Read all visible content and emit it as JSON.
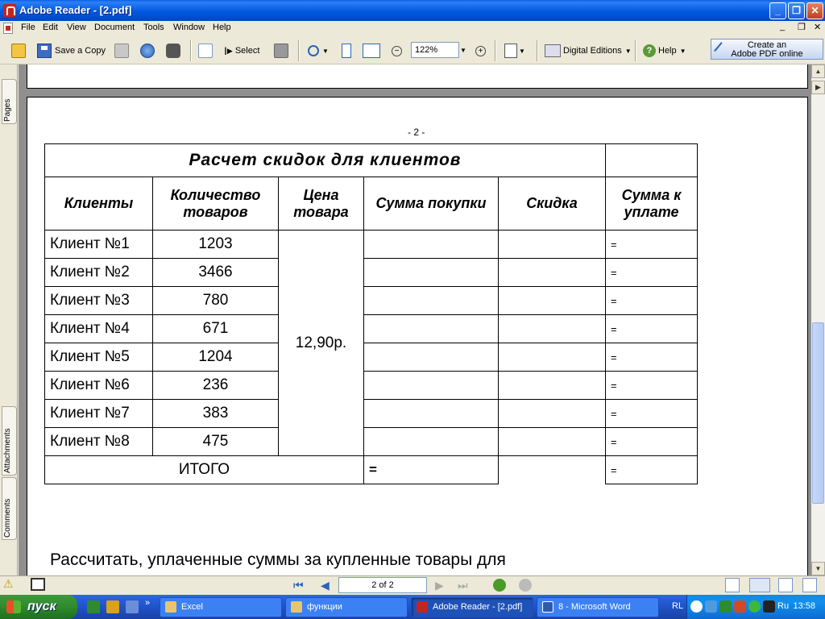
{
  "window": {
    "title": "Adobe Reader - [2.pdf]"
  },
  "menu": [
    "File",
    "Edit",
    "View",
    "Document",
    "Tools",
    "Window",
    "Help"
  ],
  "toolbar": {
    "save_copy": "Save a Copy",
    "select": "Select",
    "zoom_value": "122%",
    "digital_editions": "Digital Editions",
    "help": "Help",
    "create_line1": "Create an",
    "create_line2": "Adobe PDF online"
  },
  "nav_tabs": {
    "pages": "Pages",
    "attachments": "Attachments",
    "comments": "Comments"
  },
  "document": {
    "page_number": "- 2 -",
    "table_title": "Расчет скидок для клиентов",
    "headers": {
      "clients": "Клиенты",
      "quantity": "Количество товаров",
      "price": "Цена товара",
      "sum": "Сумма покупки",
      "discount": "Скидка",
      "to_pay": "Сумма к уплате"
    },
    "price_value": "12,90р.",
    "rows": [
      {
        "client": "Клиент №1",
        "qty": "1203",
        "pay": "="
      },
      {
        "client": "Клиент №2",
        "qty": "3466",
        "pay": "="
      },
      {
        "client": "Клиент №3",
        "qty": "780",
        "pay": "="
      },
      {
        "client": "Клиент №4",
        "qty": "671",
        "pay": "="
      },
      {
        "client": "Клиент №5",
        "qty": "1204",
        "pay": "="
      },
      {
        "client": "Клиент №6",
        "qty": "236",
        "pay": "="
      },
      {
        "client": "Клиент №7",
        "qty": "383",
        "pay": "="
      },
      {
        "client": "Клиент №8",
        "qty": "475",
        "pay": "="
      }
    ],
    "total_label": "ИТОГО",
    "total_sum": "=",
    "total_pay": "=",
    "body_text": "Рассчитать, уплаченные суммы за купленные товары для"
  },
  "statusbar": {
    "page_indicator": "2 of 2"
  },
  "taskbar": {
    "start": "пуск",
    "tasks": [
      "Excel",
      "функции",
      "Adobe Reader - [2.pdf]",
      "8 - Microsoft Word"
    ],
    "lang": "RL",
    "tray_lang": "Ru",
    "clock": "13:58"
  },
  "colors": {
    "titlebar": "#0058E0",
    "taskbar": "#245EDB",
    "start": "#2E8B2E"
  }
}
